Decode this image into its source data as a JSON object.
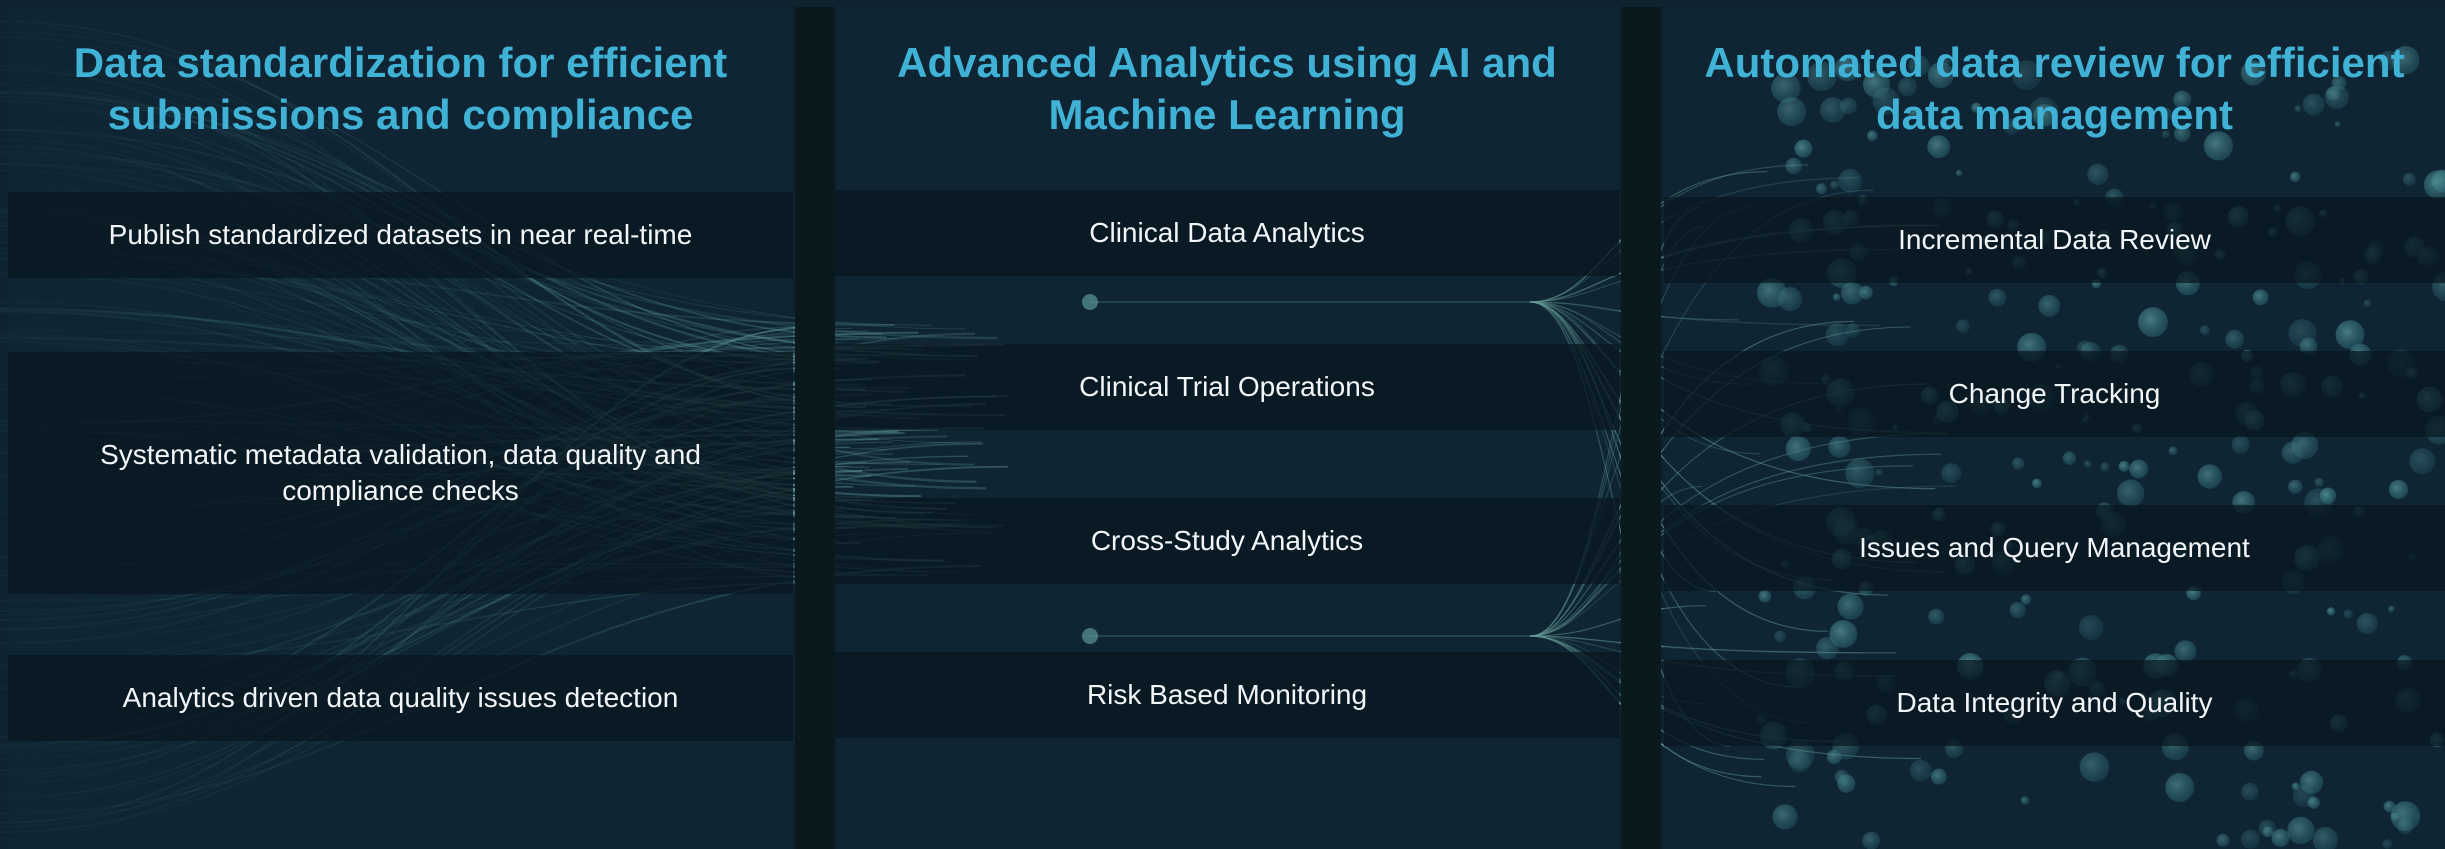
{
  "columns": [
    {
      "title": "Data standardization for efficient submissions and compliance",
      "items": [
        "Publish standardized datasets in near real-time",
        "Systematic metadata validation, data quality and compliance checks",
        "Analytics driven data quality issues detection"
      ]
    },
    {
      "title": "Advanced Analytics using AI and Machine Learning",
      "items": [
        "Clinical Data Analytics",
        "Clinical Trial Operations",
        "Cross-Study Analytics",
        "Risk Based Monitoring"
      ]
    },
    {
      "title": "Automated data review for efficient data management",
      "items": [
        "Incremental Data Review",
        "Change Tracking",
        "Issues and Query Management",
        "Data Integrity and Quality"
      ]
    }
  ],
  "colors": {
    "background": "#0e2230",
    "title": "#3fb2d6",
    "text": "#f2f6f8",
    "band": "#08161e",
    "stream": "#5fb8b0",
    "bubble": "#5fb6b8"
  }
}
